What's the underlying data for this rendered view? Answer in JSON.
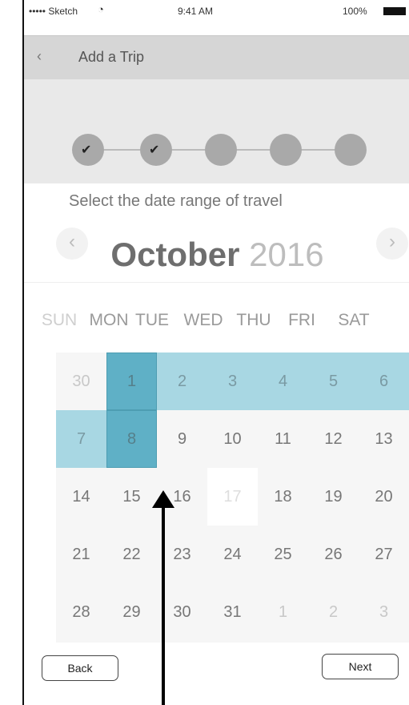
{
  "status_bar": {
    "carrier": "••••• Sketch ὏6",
    "carrier_text": "••••• Sketch",
    "time": "9:41 AM",
    "battery": "100%"
  },
  "nav": {
    "back_glyph": "‹",
    "title": "Add a Trip"
  },
  "stepper": {
    "steps": [
      {
        "done": true,
        "check": "✔"
      },
      {
        "done": true,
        "check": "✔"
      },
      {
        "done": false,
        "check": ""
      },
      {
        "done": false,
        "check": ""
      },
      {
        "done": false,
        "check": ""
      }
    ]
  },
  "prompt": "Select the date range of travel",
  "calendar": {
    "month": "October",
    "year": "2016",
    "prev_glyph": "‹",
    "next_glyph": "›",
    "weekdays": [
      "SUN",
      "MON",
      "TUE",
      "WED",
      "THU",
      "FRI",
      "SAT"
    ],
    "weeks": [
      [
        {
          "d": "30",
          "s": "muted"
        },
        {
          "d": "1",
          "s": "dark"
        },
        {
          "d": "2",
          "s": "light"
        },
        {
          "d": "3",
          "s": "light"
        },
        {
          "d": "4",
          "s": "light"
        },
        {
          "d": "5",
          "s": "light"
        },
        {
          "d": "6",
          "s": "light"
        }
      ],
      [
        {
          "d": "7",
          "s": "light"
        },
        {
          "d": "8",
          "s": "dark"
        },
        {
          "d": "9",
          "s": ""
        },
        {
          "d": "10",
          "s": ""
        },
        {
          "d": "11",
          "s": ""
        },
        {
          "d": "12",
          "s": ""
        },
        {
          "d": "13",
          "s": ""
        }
      ],
      [
        {
          "d": "14",
          "s": ""
        },
        {
          "d": "15",
          "s": ""
        },
        {
          "d": "16",
          "s": ""
        },
        {
          "d": "17",
          "s": "white"
        },
        {
          "d": "18",
          "s": ""
        },
        {
          "d": "19",
          "s": ""
        },
        {
          "d": "20",
          "s": ""
        }
      ],
      [
        {
          "d": "21",
          "s": ""
        },
        {
          "d": "22",
          "s": ""
        },
        {
          "d": "23",
          "s": ""
        },
        {
          "d": "24",
          "s": ""
        },
        {
          "d": "25",
          "s": ""
        },
        {
          "d": "26",
          "s": ""
        },
        {
          "d": "27",
          "s": ""
        }
      ],
      [
        {
          "d": "28",
          "s": ""
        },
        {
          "d": "29",
          "s": ""
        },
        {
          "d": "30",
          "s": ""
        },
        {
          "d": "31",
          "s": ""
        },
        {
          "d": "1",
          "s": "muted"
        },
        {
          "d": "2",
          "s": "muted"
        },
        {
          "d": "3",
          "s": "muted"
        }
      ]
    ]
  },
  "buttons": {
    "back": "Back",
    "next": "Next"
  },
  "colors": {
    "range_light": "#a8d7e3",
    "range_endpoint": "#5fb0c6"
  }
}
